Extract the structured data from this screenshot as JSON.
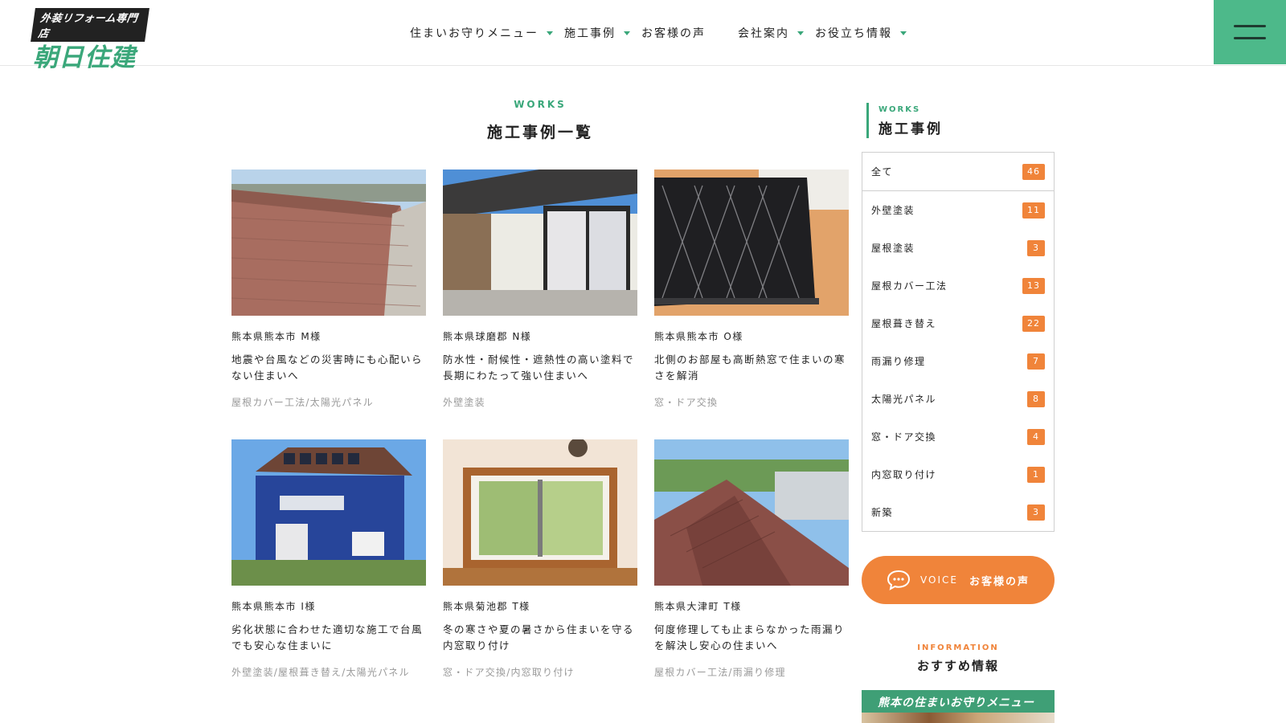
{
  "header": {
    "logo_tag": "外装リフォーム専門店",
    "logo_name": "朝日住建",
    "nav": [
      {
        "label": "住まいお守りメニュー",
        "dropdown": true
      },
      {
        "label": "施工事例",
        "dropdown": true
      },
      {
        "label": "お客様の声",
        "dropdown": false
      },
      {
        "label": "会社案内",
        "dropdown": true
      },
      {
        "label": "お役立ち情報",
        "dropdown": true
      }
    ]
  },
  "main": {
    "section_en": "WORKS",
    "section_ja": "施工事例一覧",
    "cards": [
      {
        "location": "熊本県熊本市 M様",
        "title": "地震や台風などの災害時にも心配いらない住まいへ",
        "categories": "屋根カバー工法/太陽光パネル",
        "photo": "roof-brown"
      },
      {
        "location": "熊本県球磨郡 N様",
        "title": "防水性・耐候性・遮熱性の高い塗料で長期にわたって強い住まいへ",
        "categories": "外壁塗装",
        "photo": "house-white"
      },
      {
        "location": "熊本県熊本市 O様",
        "title": "北側のお部屋も高断熱窓で住まいの寒さを解消",
        "categories": "窓・ドア交換",
        "photo": "window-lattice"
      },
      {
        "location": "熊本県熊本市 I様",
        "title": "劣化状態に合わせた適切な施工で台風でも安心な住まいに",
        "categories": "外壁塗装/屋根葺き替え/太陽光パネル",
        "photo": "house-blue"
      },
      {
        "location": "熊本県菊池郡 T様",
        "title": "冬の寒さや夏の暑さから住まいを守る内窓取り付け",
        "categories": "窓・ドア交換/内窓取り付け",
        "photo": "inner-window"
      },
      {
        "location": "熊本県大津町 T様",
        "title": "何度修理しても止まらなかった雨漏りを解決し安心の住まいへ",
        "categories": "屋根カバー工法/雨漏り修理",
        "photo": "roof-town"
      }
    ]
  },
  "sidebar": {
    "works_en": "WORKS",
    "works_ja": "施工事例",
    "categories": [
      {
        "name": "全て",
        "count": "46"
      },
      {
        "name": "外壁塗装",
        "count": "11"
      },
      {
        "name": "屋根塗装",
        "count": "3"
      },
      {
        "name": "屋根カバー工法",
        "count": "13"
      },
      {
        "name": "屋根葺き替え",
        "count": "22"
      },
      {
        "name": "雨漏り修理",
        "count": "7"
      },
      {
        "name": "太陽光パネル",
        "count": "8"
      },
      {
        "name": "窓・ドア交換",
        "count": "4"
      },
      {
        "name": "内窓取り付け",
        "count": "1"
      },
      {
        "name": "新築",
        "count": "3"
      }
    ],
    "voice_en": "VOICE",
    "voice_ja": "お客様の声",
    "info_en": "INFORMATION",
    "info_ja": "おすすめ情報",
    "banner_text": "熊本の住まいお守りメニュー"
  },
  "colors": {
    "brand_green": "#3aa77a",
    "menu_green": "#4db98a",
    "accent_orange": "#f0843a"
  }
}
